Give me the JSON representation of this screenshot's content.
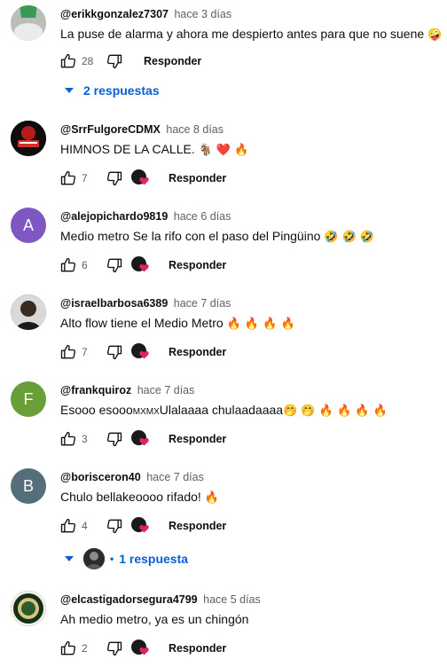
{
  "colors": {
    "link": "#065fd4",
    "text": "#0f0f0f",
    "muted": "#606060",
    "heart": "#e0245e",
    "fire": "#ff6a00"
  },
  "actions": {
    "reply_label": "Responder"
  },
  "comments": [
    {
      "handle": "@erikkgonzalez7307",
      "time": "hace 3 días",
      "text": "La puse de alarma y ahora me despierto antes para que no suene",
      "emoji": "🤪",
      "likes": "28",
      "creator_heart": false,
      "replies_label": "2 respuestas",
      "avatar": {
        "type": "photo",
        "color": "#9aa39a"
      }
    },
    {
      "handle": "@SrrFulgoreCDMX",
      "time": "hace 8 días",
      "text": "HIMNOS DE LA CALLE.",
      "emoji": "🐐 ❤️ 🔥",
      "likes": "7",
      "creator_heart": true,
      "avatar": {
        "type": "photo",
        "color": "#6b0c0c"
      }
    },
    {
      "handle": "@alejopichardo9819",
      "time": "hace 6 días",
      "text": "Medio metro Se la rifo con el paso del Pingüino",
      "emoji": "🤣 🤣 🤣",
      "likes": "6",
      "creator_heart": true,
      "avatar": {
        "type": "letter",
        "letter": "A",
        "color": "#7e57c2"
      }
    },
    {
      "handle": "@israelbarbosa6389",
      "time": "hace 7 días",
      "text": "Alto flow tiene el Medio Metro",
      "emoji": "🔥 🔥 🔥 🔥",
      "likes": "7",
      "creator_heart": true,
      "avatar": {
        "type": "photo",
        "color": "#3a3a3a"
      }
    },
    {
      "handle": "@frankquiroz",
      "time": "hace 7 días",
      "text_a": "Esooo esooo",
      "text_b": "MXMX",
      "text_c": "Ulalaaaa chulaadaaaa",
      "emoji": "🤭 🤭 🔥 🔥 🔥 🔥",
      "likes": "3",
      "creator_heart": true,
      "avatar": {
        "type": "letter",
        "letter": "F",
        "color": "#689f38"
      }
    },
    {
      "handle": "@borisceron40",
      "time": "hace 7 días",
      "text": "Chulo bellakeoooo rifado!",
      "emoji": "🔥",
      "likes": "4",
      "creator_heart": true,
      "replies_label": "1 respuesta",
      "avatar": {
        "type": "letter",
        "letter": "B",
        "color": "#546e7a"
      }
    },
    {
      "handle": "@elcastigadorsegura4799",
      "time": "hace 5 días",
      "text": "Ah medio metro, ya es un chingón",
      "likes": "2",
      "creator_heart": true,
      "avatar": {
        "type": "photo",
        "color": "#1f3d1f"
      }
    }
  ]
}
